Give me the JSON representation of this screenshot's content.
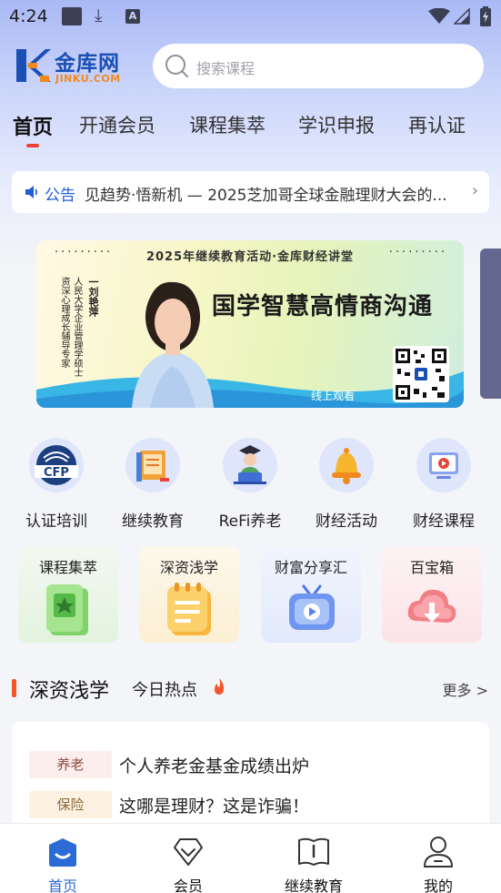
{
  "status_bar": {
    "time": "4:24"
  },
  "header": {
    "logo_name": "金库网",
    "logo_sub": "JINKU.COM",
    "search_placeholder": "搜索课程"
  },
  "tabs": [
    {
      "label": "首页",
      "active": true
    },
    {
      "label": "开通会员"
    },
    {
      "label": "课程集萃"
    },
    {
      "label": "学识申报"
    },
    {
      "label": "再认证"
    }
  ],
  "notice": {
    "tag": "公告",
    "text": "见趋势·悟新机 — 2025芝加哥全球金融理财大会的..."
  },
  "banner": {
    "top_line": "2025年继续教育活动·金库财经讲堂",
    "headline": "国学智慧高情商沟通",
    "speaker_name": "一刘艳萍",
    "speaker_title_1": "人民大学企业管理学硕士",
    "speaker_title_2": "资深心理成长辅导专家",
    "watch_label": "线上观看"
  },
  "quick_icons": [
    {
      "label": "认证培训",
      "icon": "cfp-logo-icon"
    },
    {
      "label": "继续教育",
      "icon": "book-icon"
    },
    {
      "label": "ReFi养老",
      "icon": "graduate-laptop-icon"
    },
    {
      "label": "财经活动",
      "icon": "bell-icon"
    },
    {
      "label": "财经课程",
      "icon": "monitor-play-icon"
    }
  ],
  "cards": [
    {
      "label": "课程集萃",
      "icon": "green-star-book-icon",
      "color": "#e9f6e6"
    },
    {
      "label": "深资浅学",
      "icon": "notebook-icon",
      "color": "#fdf3dc"
    },
    {
      "label": "财富分享汇",
      "icon": "tv-play-icon",
      "color": "#e8eefc"
    },
    {
      "label": "百宝箱",
      "icon": "cloud-download-icon",
      "color": "#fde8ea"
    }
  ],
  "section": {
    "title": "深资浅学",
    "subtitle": "今日热点",
    "more": "更多 >"
  },
  "news": [
    {
      "tag": "养老",
      "text": "个人养老金基金成绩出炉",
      "tag_bg": "#fdeeee",
      "tag_color": "#8a4a3a"
    },
    {
      "tag": "保险",
      "text": "这哪是理财？这是诈骗！",
      "tag_bg": "#fdf1e2",
      "tag_color": "#8a6a3a"
    }
  ],
  "bottom_nav": [
    {
      "label": "首页",
      "active": true
    },
    {
      "label": "会员"
    },
    {
      "label": "继续教育"
    },
    {
      "label": "我的"
    }
  ],
  "colors": {
    "accent_blue": "#2b6bd6",
    "tab_indicator": "#e8443a",
    "section_bar": "#f2572c"
  }
}
